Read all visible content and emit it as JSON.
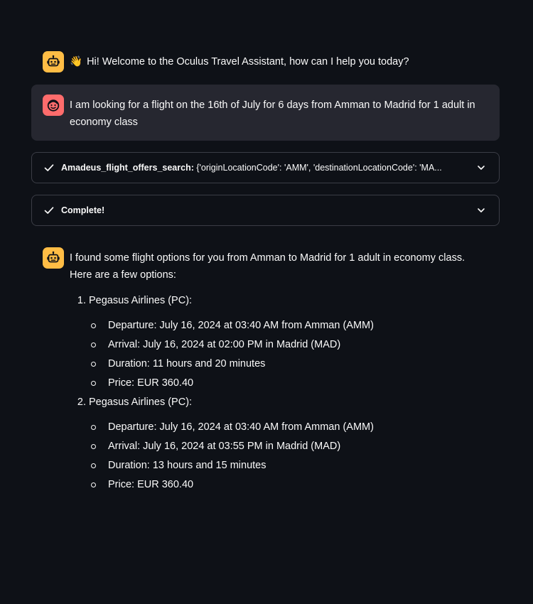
{
  "chat": {
    "welcome": {
      "emoji": "👋",
      "text": "Hi! Welcome to the Oculus Travel Assistant, how can I help you today?"
    },
    "user_message": {
      "text": "I am looking for a flight on the 16th of July for 6 days from Amman to Madrid for 1 adult in economy class"
    },
    "tool_call": {
      "name": "Amadeus_flight_offers_search:",
      "args": "{'originLocationCode': 'AMM', 'destinationLocationCode': 'MA..."
    },
    "status": {
      "label": "Complete!"
    },
    "response": {
      "intro": "I found some flight options for you from Amman to Madrid for 1 adult in economy class. Here are a few options:",
      "options": [
        {
          "title": "Pegasus Airlines (PC):",
          "details": [
            "Departure: July 16, 2024 at 03:40 AM from Amman (AMM)",
            "Arrival: July 16, 2024 at 02:00 PM in Madrid (MAD)",
            "Duration: 11 hours and 20 minutes",
            "Price: EUR 360.40"
          ]
        },
        {
          "title": "Pegasus Airlines (PC):",
          "details": [
            "Departure: July 16, 2024 at 03:40 AM from Amman (AMM)",
            "Arrival: July 16, 2024 at 03:55 PM in Madrid (MAD)",
            "Duration: 13 hours and 15 minutes",
            "Price: EUR 360.40"
          ]
        }
      ]
    }
  },
  "colors": {
    "background": "#0e1117",
    "bot_avatar": "#ffbd45",
    "user_avatar": "#ff6c6c",
    "user_bubble": "#262730",
    "text": "#fafafa"
  },
  "icons": {
    "bot_avatar": "robot-face-icon",
    "user_avatar": "smiley-face-icon",
    "expander_status": "check-icon",
    "expander_toggle": "chevron-down-icon"
  }
}
